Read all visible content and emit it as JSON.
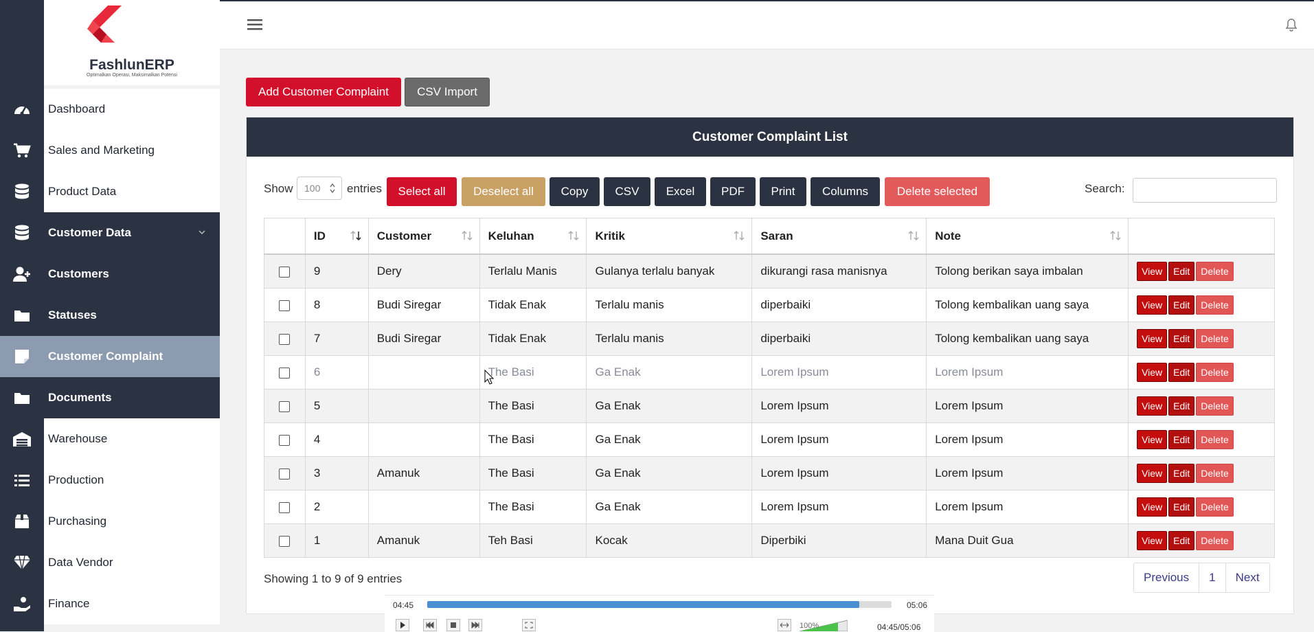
{
  "brand": {
    "name": "FashlunERP",
    "tagline": "Optimalkan Operasi, Maksimalkan Potensi",
    "accent": "#d3102c",
    "sidebar_dark": "#2b3242",
    "active_bg": "#8d9bb0"
  },
  "sidebar": {
    "items": [
      {
        "label": "Dashboard",
        "icon": "speedometer-icon"
      },
      {
        "label": "Sales and Marketing",
        "icon": "shopping-cart-icon"
      },
      {
        "label": "Product Data",
        "icon": "database-icon"
      },
      {
        "label": "Customer Data",
        "icon": "database-icon",
        "expanded": true
      },
      {
        "label": "Customers",
        "icon": "user-plus-icon"
      },
      {
        "label": "Statuses",
        "icon": "folder-icon"
      },
      {
        "label": "Customer Complaint",
        "icon": "note-icon",
        "active": true
      },
      {
        "label": "Documents",
        "icon": "folder-icon"
      },
      {
        "label": "Warehouse",
        "icon": "warehouse-icon"
      },
      {
        "label": "Production",
        "icon": "list-icon"
      },
      {
        "label": "Purchasing",
        "icon": "box-icon"
      },
      {
        "label": "Data Vendor",
        "icon": "diamond-icon"
      },
      {
        "label": "Finance",
        "icon": "hand-money-icon"
      }
    ]
  },
  "toolbar": {
    "add_label": "Add Customer Complaint",
    "csv_import_label": "CSV Import"
  },
  "card": {
    "title": "Customer Complaint List",
    "show_label": "Show",
    "entries_label": "entries",
    "page_length": "100",
    "search_label": "Search:",
    "search_value": "",
    "buttons": {
      "select_all": "Select all",
      "deselect_all": "Deselect all",
      "copy": "Copy",
      "csv": "CSV",
      "excel": "Excel",
      "pdf": "PDF",
      "print": "Print",
      "columns": "Columns",
      "delete_selected": "Delete selected"
    }
  },
  "table": {
    "headers": {
      "id": "ID",
      "customer": "Customer",
      "keluhan": "Keluhan",
      "kritik": "Kritik",
      "saran": "Saran",
      "note": "Note"
    },
    "actions": {
      "view": "View",
      "edit": "Edit",
      "delete": "Delete"
    },
    "rows": [
      {
        "id": "9",
        "customer": "Dery",
        "keluhan": "Terlalu Manis",
        "kritik": "Gulanya terlalu banyak",
        "saran": "dikurangi rasa manisnya",
        "note": "Tolong berikan saya imbalan"
      },
      {
        "id": "8",
        "customer": "Budi Siregar",
        "keluhan": "Tidak Enak",
        "kritik": "Terlalu manis",
        "saran": "diperbaiki",
        "note": "Tolong kembalikan uang saya"
      },
      {
        "id": "7",
        "customer": "Budi Siregar",
        "keluhan": "Tidak Enak",
        "kritik": "Terlalu manis",
        "saran": "diperbaiki",
        "note": "Tolong kembalikan uang saya"
      },
      {
        "id": "6",
        "customer": "",
        "keluhan": "The Basi",
        "kritik": "Ga Enak",
        "saran": "Lorem Ipsum",
        "note": "Lorem Ipsum"
      },
      {
        "id": "5",
        "customer": "",
        "keluhan": "The Basi",
        "kritik": "Ga Enak",
        "saran": "Lorem Ipsum",
        "note": "Lorem Ipsum"
      },
      {
        "id": "4",
        "customer": "",
        "keluhan": "The Basi",
        "kritik": "Ga Enak",
        "saran": "Lorem Ipsum",
        "note": "Lorem Ipsum"
      },
      {
        "id": "3",
        "customer": "Amanuk",
        "keluhan": "The Basi",
        "kritik": "Ga Enak",
        "saran": "Lorem Ipsum",
        "note": "Lorem Ipsum"
      },
      {
        "id": "2",
        "customer": "",
        "keluhan": "The Basi",
        "kritik": "Ga Enak",
        "saran": "Lorem Ipsum",
        "note": "Lorem Ipsum"
      },
      {
        "id": "1",
        "customer": "Amanuk",
        "keluhan": "Teh Basi",
        "kritik": "Kocak",
        "saran": "Diperbiki",
        "note": "Mana Duit Gua"
      }
    ]
  },
  "footer": {
    "info": "Showing 1 to 9 of 9 entries",
    "prev": "Previous",
    "page": "1",
    "next": "Next"
  },
  "player": {
    "elapsed": "04:45",
    "total": "05:06",
    "progress": 0.93,
    "volume": "100%",
    "combined": "04:45/05:06"
  }
}
